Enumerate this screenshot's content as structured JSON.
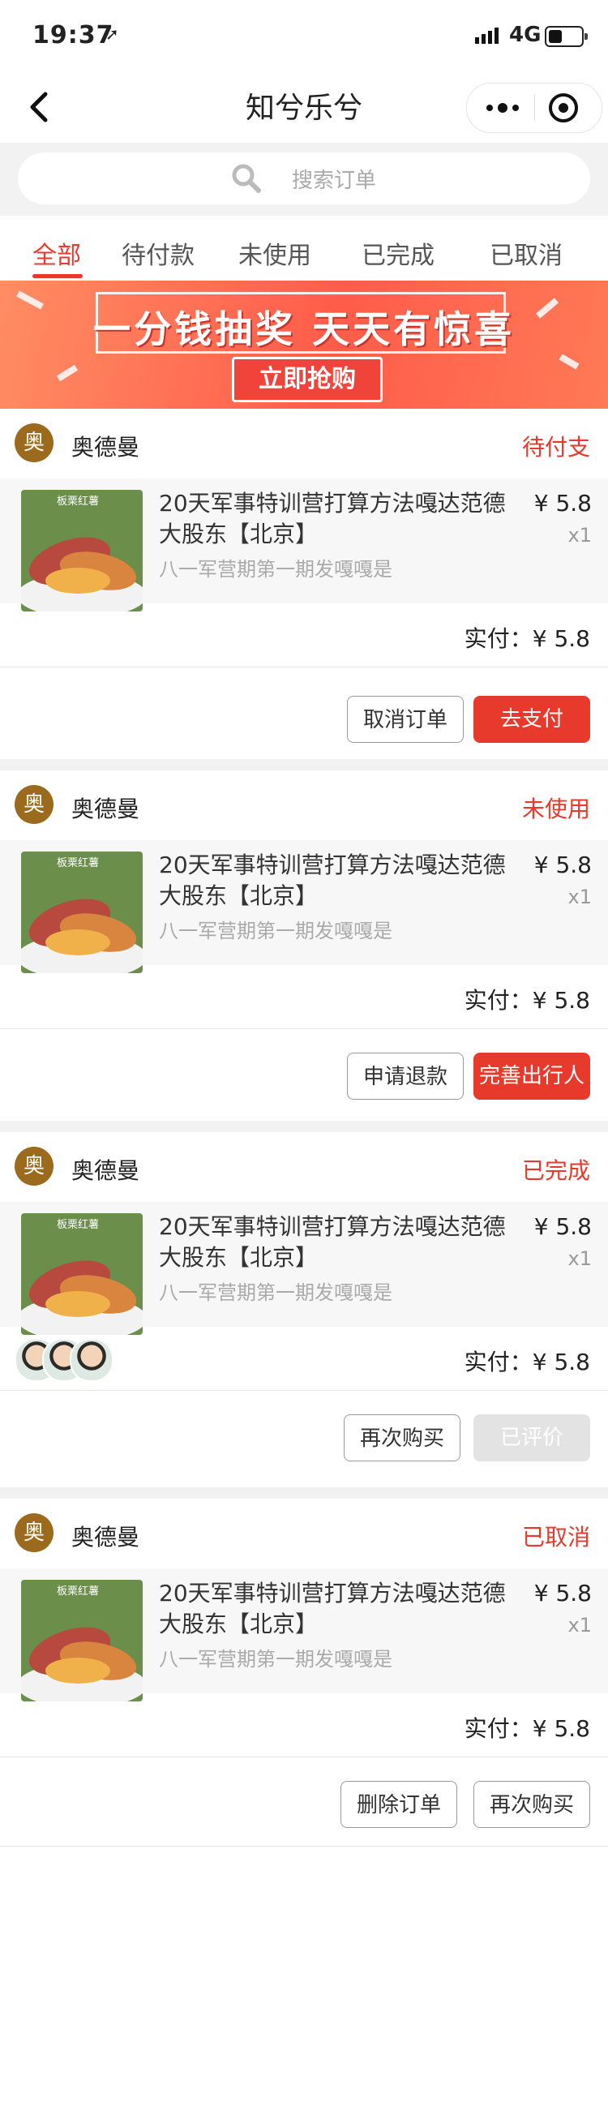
{
  "status_bar": {
    "time": "19:37",
    "network": "4G"
  },
  "nav": {
    "title": "知兮乐兮"
  },
  "search": {
    "placeholder": "搜索订单"
  },
  "tabs": [
    {
      "label": "全部",
      "active": true
    },
    {
      "label": "待付款"
    },
    {
      "label": "未使用"
    },
    {
      "label": "已完成"
    },
    {
      "label": "已取消"
    }
  ],
  "banner": {
    "headline": "一分钱抽奖 天天有惊喜",
    "cta": "立即抢购"
  },
  "orders": [
    {
      "shop_avatar": "奥",
      "shop_name": "奥德曼",
      "status": "待付支",
      "goods_name": "20天军事特训营打算方法嘎达范德大股东【北京】",
      "goods_sub": "八一军营期第一期发嘎嘎是",
      "price": "¥ 5.8",
      "qty": "x1",
      "thumb_text": "板栗红薯",
      "paid": "实付：¥ 5.8",
      "buttons": [
        "取消订单",
        "去支付"
      ]
    },
    {
      "shop_avatar": "奥",
      "shop_name": "奥德曼",
      "status": "未使用",
      "goods_name": "20天军事特训营打算方法嘎达范德大股东【北京】",
      "goods_sub": "八一军营期第一期发嘎嘎是",
      "price": "¥ 5.8",
      "qty": "x1",
      "thumb_text": "板栗红薯",
      "paid": "实付：¥ 5.8",
      "buttons": [
        "申请退款",
        "完善出行人"
      ]
    },
    {
      "shop_avatar": "奥",
      "shop_name": "奥德曼",
      "status": "已完成",
      "goods_name": "20天军事特训营打算方法嘎达范德大股东【北京】",
      "goods_sub": "八一军营期第一期发嘎嘎是",
      "price": "¥ 5.8",
      "qty": "x1",
      "thumb_text": "板栗红薯",
      "paid": "实付：¥ 5.8",
      "buttons": [
        "再次购买",
        "已评价"
      ]
    },
    {
      "shop_avatar": "奥",
      "shop_name": "奥德曼",
      "status": "已取消",
      "goods_name": "20天军事特训营打算方法嘎达范德大股东【北京】",
      "goods_sub": "八一军营期第一期发嘎嘎是",
      "price": "¥ 5.8",
      "qty": "x1",
      "thumb_text": "板栗红薯",
      "paid": "实付：¥ 5.8",
      "buttons": [
        "删除订单",
        "再次购买"
      ]
    }
  ],
  "colors": {
    "accent": "#e83a2c",
    "shop_avatar": "#9b6a1c",
    "background": "#f2f2f2"
  }
}
